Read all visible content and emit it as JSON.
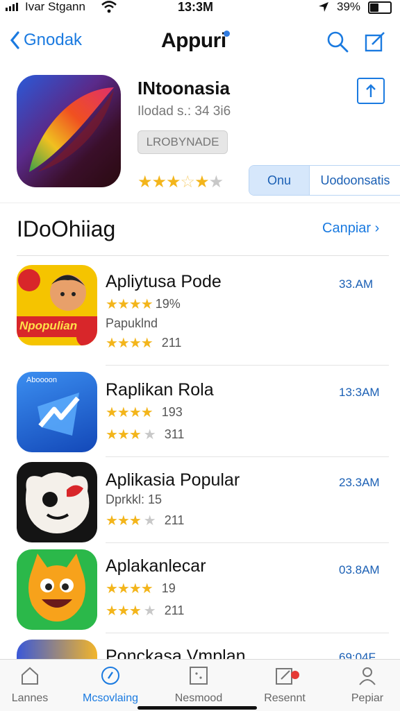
{
  "status": {
    "carrier": "Ivar Stgann",
    "time": "13:3M",
    "battery": "39%"
  },
  "nav": {
    "back_label": "Gnodak",
    "title": "Appuri"
  },
  "hero": {
    "title": "INtoonasia",
    "subtitle": "Ilodad s.: 34 3i6",
    "badge": "LROBYNADE",
    "rating_stars": 3.5,
    "segment": [
      "Onu",
      "Uodoonsatis"
    ]
  },
  "section": {
    "title": "IDoOhiiag",
    "see_all": "Canpiar"
  },
  "apps": [
    {
      "name": "Apliytusa Pode",
      "rating_text": "19%",
      "sub": "Papuklnd",
      "count": "211",
      "size": "33.AM",
      "stars": 4,
      "stars2": 4,
      "icon_text": "Npopulian"
    },
    {
      "name": "Raplikan Rola",
      "rating_text": "193",
      "sub": "",
      "count": "311",
      "size": "13:3AM",
      "stars": 4,
      "stars2": 3.5,
      "icon_text": "Aboooon"
    },
    {
      "name": "Aplikasia Popular",
      "rating_text": "",
      "sub": "Dprkkl: 15",
      "count": "211",
      "size": "23.3AM",
      "stars": 0,
      "stars2": 3.5,
      "icon_text": ""
    },
    {
      "name": "Aplakanlecar",
      "rating_text": "19",
      "sub": "",
      "count": "211",
      "size": "03.8AM",
      "stars": 4,
      "stars2": 3.5,
      "icon_text": ""
    },
    {
      "name": "Ponckasa Vmplan",
      "rating_text": "",
      "sub": "",
      "count": "",
      "size": "69:04F",
      "stars": 0,
      "stars2": 0,
      "icon_text": ""
    }
  ],
  "tabs": [
    {
      "label": "Lannes",
      "icon": "home-icon",
      "active": false
    },
    {
      "label": "Mcsovlaing",
      "icon": "compass-icon",
      "active": true
    },
    {
      "label": "Nesmood",
      "icon": "grid-icon",
      "active": false
    },
    {
      "label": "Resennt",
      "icon": "updates-icon",
      "active": false
    },
    {
      "label": "Pepiar",
      "icon": "person-icon",
      "active": false
    }
  ],
  "colors": {
    "accent": "#1a7ae0",
    "star": "#f3b51b"
  }
}
